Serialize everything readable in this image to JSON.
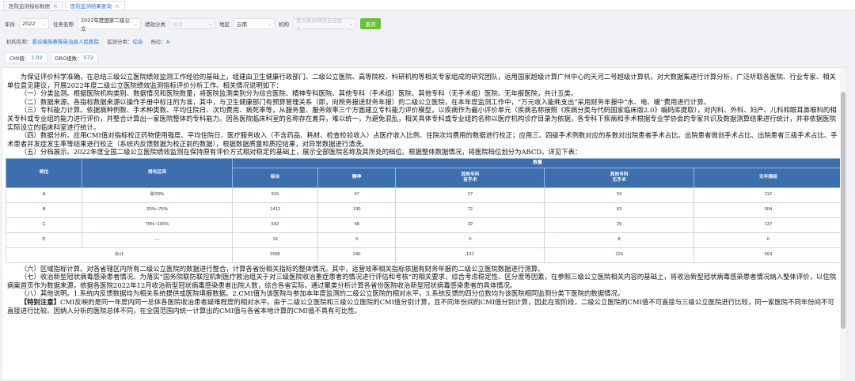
{
  "tabs": [
    {
      "label": "医院监测指标数据",
      "active": false
    },
    {
      "label": "医院监测结果查询",
      "active": true
    }
  ],
  "filters": {
    "year_label": "年份",
    "year_value": "2022",
    "task_label": "任务名称",
    "task_value": "2022年度国家二级公立",
    "perf_label": "绩效分类",
    "perf_value": "综合",
    "region_label": "地区",
    "region_value": "云南",
    "org_label": "机构",
    "org_value": "景谷傣族彝族自治县人",
    "query_label": "查询"
  },
  "info": {
    "org_name_label": "机构名称：",
    "org_name_value": "景谷傣族彝族自治县人民医院",
    "category_label": "监测分类：",
    "category_value": "综合",
    "rank_label": "档位：",
    "rank_value": "A"
  },
  "cards": [
    {
      "label": "CMI值：",
      "value": "1.02"
    },
    {
      "label": "DRG组数：",
      "value": "572"
    }
  ],
  "doc": {
    "para1": "为保证评价科学准确，在总结三级公立医院绩效监测工作经验的基础上，组建由卫生健康行政部门、二级公立医院、高等院校、科研机构等相关专家组成的研究团队，运用国家超级计算广州中心的天河二号超级计算机，对大数据集进行计算分析，广泛听取各医院、行业专家、相关单位意见建议，开展2022年度二级公立医院绩效监测指标评价分析工作。相关情况说明如下：",
    "para2": "（一）分类监测。根据医院机构类别、数据情况和医院数量，将医院监测类别分为综合医院、精神专科医院、其他专科（手术组）医院、其他专科（无手术组）医院、无年报医院，共计五类。",
    "para3": "（二）数据来源。各指标数据来源以操作手册中标注的为准，其中，与卫生健康部门有预算管理关系（即，向税务报送财务年报）的二级公立医院，在本年度监测工作中，“万元收入能耗支出”采用财务年报中“水、电、暖”费用进行计算。",
    "para4": "（三）专科能力计算。依据病种例数、手术种类数、平均住院日、次均费用、病死率等，从服务量、服务效率三个方面建立专科能力评价模型，以疾病作为最小评价单元（疾病名称按照《疾病分类与代码国家临床版2.0》编码库提取），对内科、外科、妇产、儿科和眼耳鼻喉科的相关专科或专业组的能力进行评价，并整合计算出一家医院整体的专科能力。因各医院临床科室的名称存在差异，难以统一，为避免混乱，相关具体专科或专业组的名称以医疗机构诊疗目录为依据，各专科下疾病和手术根据专业学协会的专家共识及数据测算结果进行统计，并非依据医院实际设立的临床科室进行统计。",
    "para5": "（四）数据分析。应用CMI值对指标校正药物使用强度、平均住院日、医疗服务收入（不含药品、耗材、检查检验收入）占医疗收入比例、住院次均费用的数据进行校正；应用三、四级手术例数对应的系数对出院患者手术占比、出院患者微创手术占比、出院患者三级手术占比、手术患者并发症发生率等结果进行校正（系统内反馈数据为校正前的数据），根据数据质量和质控结果，对异常数据进行清洗。",
    "para6": "（五）分档展示。2022年度全国二级公立医院绩效监测在保持原有评价方式相对稳定的基础上，展示全部医院名称及其所处的档位。根据整体数据情况，将医院档位划分为ABCD。详见下表：",
    "table": {
      "h_rank": "档位",
      "h_range": "排名区间",
      "h_count": "数量",
      "h_cols": [
        "综合",
        "精神",
        "其他专科\n有手术",
        "其他专科\n无手术",
        "无年报组"
      ],
      "rows": [
        {
          "rank": "A",
          "range": "前20%",
          "vals": [
            "515",
            "47",
            "27",
            "24",
            "112"
          ]
        },
        {
          "rank": "B",
          "range": "20%~75%",
          "vals": [
            "1412",
            "130",
            "72",
            "63",
            "304"
          ]
        },
        {
          "rank": "C",
          "range": "75%~100%",
          "vals": [
            "642",
            "58",
            "32",
            "29",
            "137"
          ]
        },
        {
          "rank": "D",
          "range": "—",
          "vals": [
            "16",
            "5",
            "0",
            "8",
            "0"
          ]
        },
        {
          "rank": "合计",
          "range": "",
          "vals": [
            "2585",
            "240",
            "131",
            "124",
            "553"
          ]
        }
      ]
    },
    "para7": "（六）区域指标计算。对各省辖区内所有二级公立医院的数据进行整合，计算各省份相关指标的整体情况。其中，运营效率相关指标依据有财务年报的二级公立医院数据进行测算。",
    "para8": "（七）收治新型冠状病毒感染患者情况。为落实“国务院联防联控机制医疗救治组关于对三级医院收治重症患者的情况进行评估和考核”的相关要求，综合考虑稳定性、区分度等因素，在参照三级公立医院相关内容的基础上，将收治新型冠状病毒感染患者情况纳入整体评价，以住院病案首页作为数据来源，依据各医院2022年12月收治新型冠状病毒感染患者出院人数，综合各省实际，通过聚类分析计算各省份医院收治新型冠状病毒感染患者的具体情况。",
    "para9": "（八）其他说明。1.系统内反馈数据均为相关系统提供或医院填报数据。2.CMI值为该医院与参加本年度监测的二级公立医院的相对水平。3.系统反馈的四分位数均为该医院相同监测分类下医院的数据情况。",
    "special_label": "【特别注意】",
    "special_text": "CMI反映的是同一年度内同一总体各医院收治患者疑难程度的相对水平。由于二级公立医院和三级公立医院的CMI值分别计算，且不同年份间的CMI值分别计算，因此在现阶段，二级公立医院的CMI值不可直接与三级公立医院进行比较，同一家医院不同年份间不可直接进行比较。因纳入分析的医院总体不同，在全国范围内统一计算出的CMI值与各省本地计算的CMI值不具有可比性。"
  }
}
